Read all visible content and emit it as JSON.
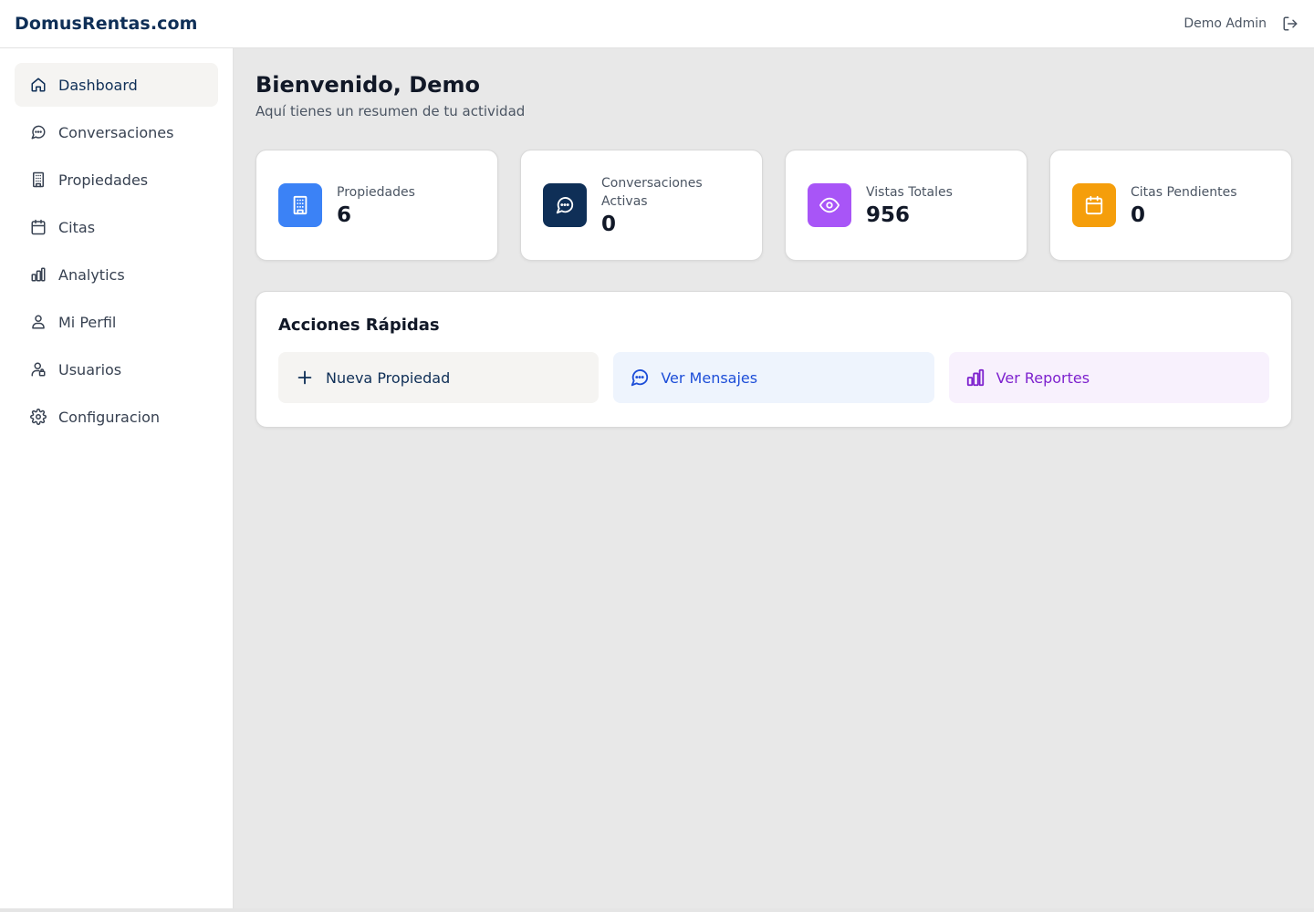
{
  "header": {
    "brand": "DomusRentas.com",
    "user_name": "Demo Admin",
    "logout_icon": "logout-icon"
  },
  "sidebar": {
    "items": [
      {
        "label": "Dashboard",
        "icon": "home-icon",
        "active": true
      },
      {
        "label": "Conversaciones",
        "icon": "chat-icon",
        "active": false
      },
      {
        "label": "Propiedades",
        "icon": "building-icon",
        "active": false
      },
      {
        "label": "Citas",
        "icon": "calendar-icon",
        "active": false
      },
      {
        "label": "Analytics",
        "icon": "bar-chart-icon",
        "active": false
      },
      {
        "label": "Mi Perfil",
        "icon": "user-icon",
        "active": false
      },
      {
        "label": "Usuarios",
        "icon": "users-icon",
        "active": false
      },
      {
        "label": "Configuracion",
        "icon": "gear-icon",
        "active": false
      }
    ]
  },
  "main": {
    "welcome": "Bienvenido, Demo",
    "subtitle": "Aquí tienes un resumen de tu actividad",
    "stats": [
      {
        "label": "Propiedades",
        "value": "6",
        "icon": "building-icon",
        "color": "#3b82f6"
      },
      {
        "label": "Conversaciones Activas",
        "value": "0",
        "icon": "chat-icon",
        "color": "#0f2f57"
      },
      {
        "label": "Vistas Totales",
        "value": "956",
        "icon": "eye-icon",
        "color": "#a855f7"
      },
      {
        "label": "Citas Pendientes",
        "value": "0",
        "icon": "calendar-icon",
        "color": "#f59e0b"
      }
    ],
    "quick_actions": {
      "title": "Acciones Rápidas",
      "items": [
        {
          "label": "Nueva Propiedad",
          "icon": "plus-icon"
        },
        {
          "label": "Ver Mensajes",
          "icon": "chat-icon"
        },
        {
          "label": "Ver Reportes",
          "icon": "bar-chart-icon"
        }
      ]
    }
  },
  "colors": {
    "brand": "#0f2f57",
    "background": "#e8e8e8",
    "active_nav": "#f5f4f2"
  }
}
